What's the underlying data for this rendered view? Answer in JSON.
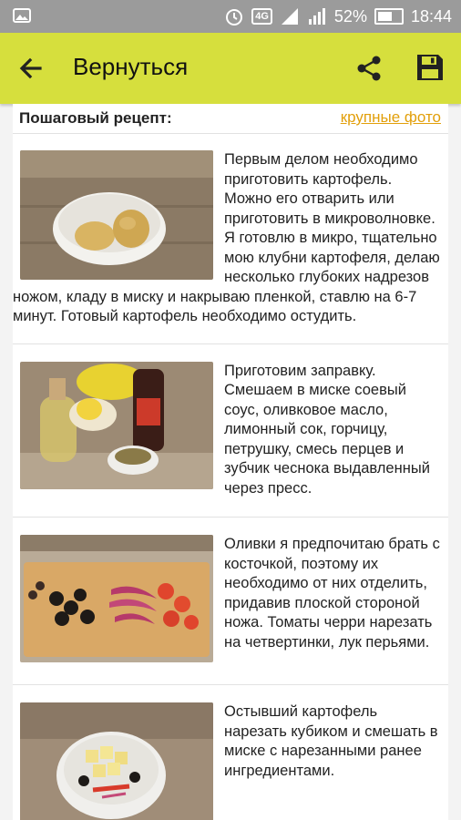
{
  "status_bar": {
    "network": "4G",
    "battery": "52%",
    "time": "18:44"
  },
  "app_bar": {
    "back_label": "Вернуться",
    "icons": [
      "back-arrow-icon",
      "share-icon",
      "save-icon"
    ]
  },
  "recipe": {
    "heading": "Пошаговый рецепт:",
    "large_photos_link": "крупные фото",
    "steps": [
      {
        "text": "Первым делом необходимо приготовить картофель. Можно его отварить или приготовить в микроволновке. Я готовлю в микро, тщательно мою клубни картофеля, делаю несколько глубоких надрезов ножом, кладу в миску и накрываю пленкой, ставлю на 6-7 минут. Готовый картофель необходимо остудить."
      },
      {
        "text": "Приготовим заправку. Смешаем в миске соевый соус, оливковое масло, лимонный сок, горчицу, петрушку, смесь перцев и зубчик чеснока выдавленный через пресс."
      },
      {
        "text": "Оливки я предпочитаю брать с косточкой, поэтому их необходимо от них отделить, придавив плоской стороной ножа. Томаты черри нарезать на четвертинки, лук перьями."
      },
      {
        "text": "Остывший картофель нарезать кубиком и смешать в миске с нарезанными ранее ингредиентами."
      }
    ]
  },
  "colors": {
    "app_bar": "#d6df3d",
    "link": "#e29f0a",
    "status_bar": "#9b9b9b"
  }
}
